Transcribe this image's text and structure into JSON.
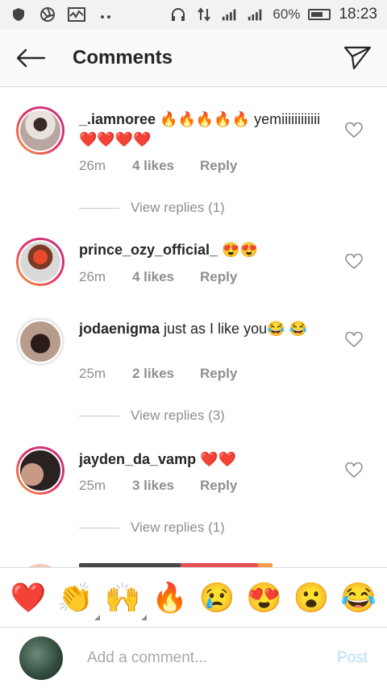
{
  "status_bar": {
    "battery_pct": "60%",
    "time": "18:23"
  },
  "header": {
    "title": "Comments"
  },
  "comments": [
    {
      "username": "_.iamnoree",
      "text": " 🔥🔥🔥🔥🔥 yemiiiiiiiiiiii❤️❤️❤️❤️",
      "time": "26m",
      "likes": "4 likes",
      "reply": "Reply",
      "view_replies": "View replies (1)"
    },
    {
      "username": "prince_ozy_official_",
      "text": " 😍😍",
      "time": "26m",
      "likes": "4 likes",
      "reply": "Reply"
    },
    {
      "username": "jodaenigma",
      "text": " just as I like you😂 😂",
      "time": "25m",
      "likes": "2 likes",
      "reply": "Reply",
      "view_replies": "View replies (3)"
    },
    {
      "username": "jayden_da_vamp",
      "text": " ❤️❤️",
      "time": "25m",
      "likes": "3 likes",
      "reply": "Reply",
      "view_replies": "View replies (1)"
    }
  ],
  "emoji_bar": [
    "❤️",
    "👏",
    "🙌",
    "🔥",
    "😢",
    "😍",
    "😮",
    "😂"
  ],
  "composer": {
    "placeholder": "Add a comment...",
    "post_label": "Post"
  },
  "colors": {
    "text": "#262626",
    "meta": "#8e8e8e",
    "post_disabled": "#b3dbff",
    "ring_gradient": [
      "#f9a13a",
      "#e1306c",
      "#c13584"
    ]
  }
}
